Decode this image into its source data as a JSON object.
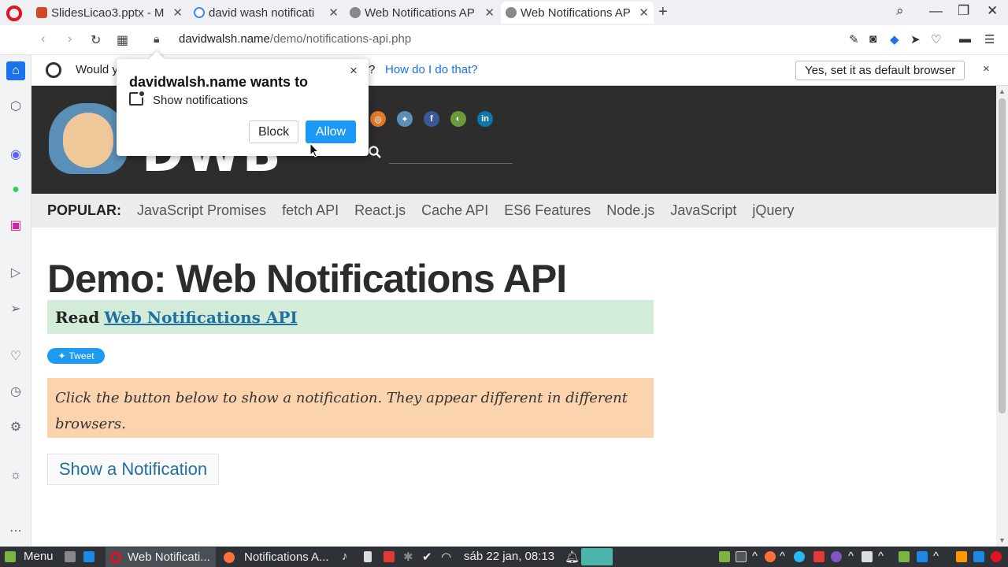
{
  "browser": {
    "tabs": [
      {
        "label": "SlidesLicao3.pptx - M",
        "icon_color": "#d24726",
        "active": false
      },
      {
        "label": "david wash notificati",
        "icon_color": "#4285f4",
        "active": false
      },
      {
        "label": "Web Notifications AP",
        "icon_color": "#777777",
        "active": false
      },
      {
        "label": "Web Notifications AP",
        "icon_color": "#777777",
        "active": true
      }
    ],
    "new_tab": "+",
    "url_domain": "davidwalsh.name",
    "url_path": "/demo/notifications-api.php"
  },
  "infobar": {
    "text_start": "Would y",
    "text_end": "?",
    "link": "How do I do that?",
    "button": "Yes, set it as default browser",
    "close": "×"
  },
  "popup": {
    "title": "davidwalsh.name wants to",
    "permission": "Show notifications",
    "block_label": "Block",
    "allow_label": "Allow",
    "close": "×"
  },
  "site": {
    "logo_text": "DWB",
    "social_icons": [
      "rss-icon",
      "twitter-icon",
      "facebook-icon",
      "github-icon",
      "linkedin-icon"
    ],
    "popular_label": "POPULAR:",
    "popular_links": [
      "JavaScript Promises",
      "fetch API",
      "React.js",
      "Cache API",
      "ES6 Features",
      "Node.js",
      "JavaScript",
      "jQuery"
    ],
    "title": "Demo: Web Notifications API",
    "read_prefix": "Read",
    "read_link": "Web Notifications API",
    "tweet_label": "Tweet",
    "notice": "Click the button below to show a notification. They appear different in different browsers.",
    "show_button": "Show a Notification"
  },
  "taskbar": {
    "menu_label": "Menu",
    "windows": [
      {
        "label": "Web Notificati...",
        "active": true
      },
      {
        "label": "Notifications A...",
        "active": false
      }
    ],
    "clock": "sáb 22 jan, 08:13"
  },
  "colors": {
    "accent_blue": "#1c98f7",
    "read_box_bg": "#d3ecd9",
    "notice_bg": "#fbd3ad",
    "header_bg": "#2d2d2d"
  }
}
